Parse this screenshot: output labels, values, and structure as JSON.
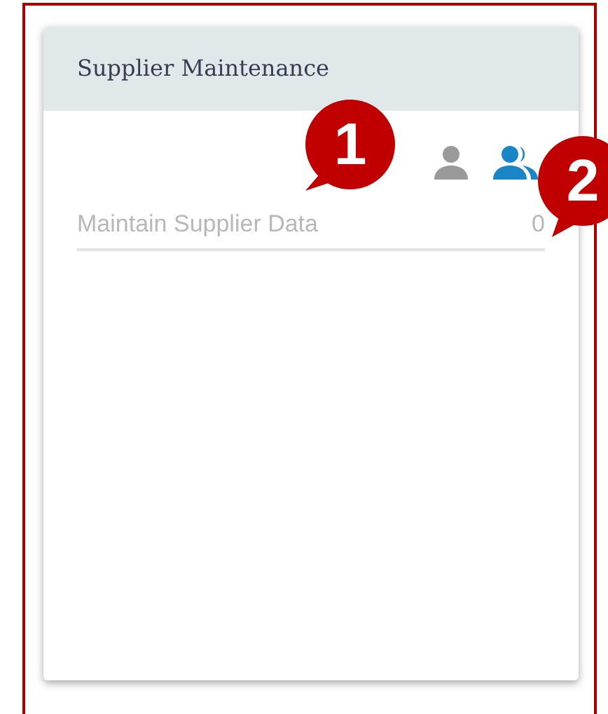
{
  "card": {
    "title": "Supplier Maintenance",
    "view_toggles": [
      {
        "kind": "single",
        "selected": false
      },
      {
        "kind": "group",
        "selected": true
      }
    ],
    "rows": [
      {
        "label": "Maintain Supplier Data",
        "count": "0",
        "disabled": true
      }
    ]
  },
  "callouts": [
    {
      "label": "1"
    },
    {
      "label": "2"
    }
  ]
}
